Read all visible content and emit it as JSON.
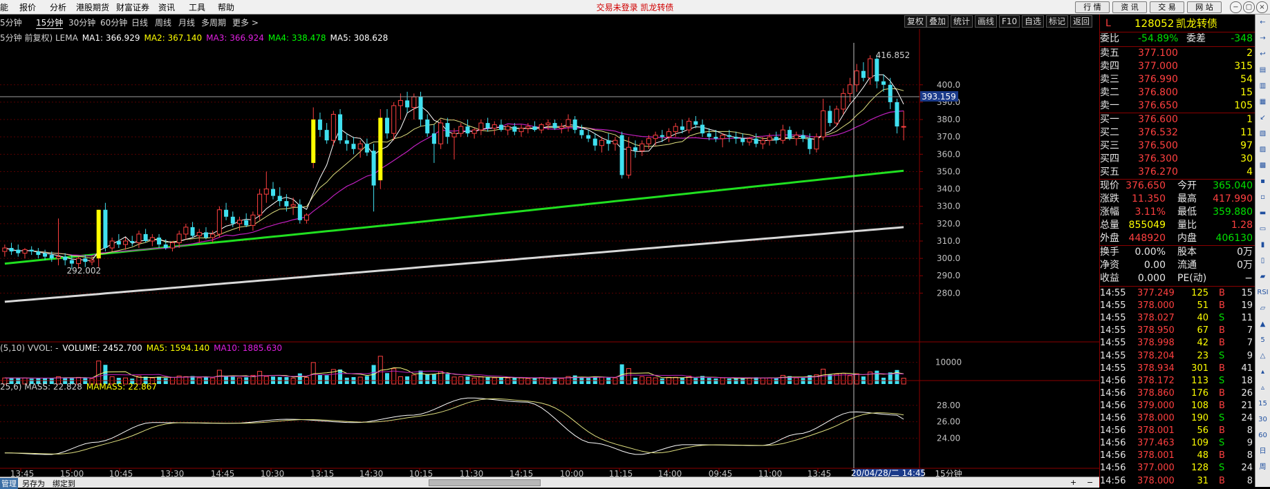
{
  "menubar": {
    "items": [
      "能",
      "报价",
      "分析",
      "港股期货",
      "财富证券",
      "资讯",
      "工具",
      "帮助"
    ],
    "center_text": "交易未登录 凯龙转债",
    "right_buttons": [
      "行 情",
      "资 讯",
      "交 易",
      "网 站"
    ],
    "window_controls": [
      "−",
      "▢",
      "×"
    ]
  },
  "tabbar": {
    "tabs": [
      "5分钟",
      "15分钟",
      "30分钟",
      "60分钟",
      "日线",
      "周线",
      "月线",
      "多周期",
      "更多 >"
    ],
    "active": "15分钟",
    "right_tabs": [
      "复权",
      "叠加",
      "统计",
      "画线",
      "F10",
      "自选",
      "标记",
      "返回"
    ]
  },
  "indicator_lines": {
    "main": {
      "prefix": "5分钟 前复权) LEMA",
      "items": [
        {
          "label": "MA1: 366.929",
          "color": "#ffffff"
        },
        {
          "label": "MA2: 367.140",
          "color": "#ffff00"
        },
        {
          "label": "MA3: 366.924",
          "color": "#e020e0"
        },
        {
          "label": "MA4: 338.478",
          "color": "#00ff00"
        },
        {
          "label": "MA5: 308.628",
          "color": "#ffffff"
        }
      ]
    },
    "volume": {
      "prefix": "(5,10) VVOL: -",
      "items": [
        {
          "label": "VOLUME: 2452.700",
          "color": "#ffffff"
        },
        {
          "label": "MA5: 1594.140",
          "color": "#ffff00"
        },
        {
          "label": "MA10: 1885.630",
          "color": "#e020e0"
        }
      ]
    },
    "mass": {
      "prefix": "25,6) MASS: 22.828",
      "items": [
        {
          "label": "MAMASS: 22.867",
          "color": "#ffff00"
        }
      ]
    }
  },
  "chart_data": {
    "type": "candlestick",
    "price_axis": {
      "ticks": [
        280,
        290,
        300,
        310,
        320,
        330,
        340,
        350,
        360,
        370,
        380,
        390,
        400
      ],
      "ylim": [
        271,
        421
      ]
    },
    "price_marker": "393.159",
    "high_label": "416.852",
    "low_label": "292.002",
    "volume_axis": {
      "ticks": [
        10000
      ]
    },
    "mass_axis": {
      "ticks": [
        "24.00",
        "26.00",
        "28.00"
      ],
      "ylim": [
        21,
        29.5
      ]
    },
    "x_labels": [
      "13:45",
      "15:00",
      "10:45",
      "13:30",
      "14:45",
      "10:30",
      "13:15",
      "14:30",
      "10:15",
      "11:30",
      "14:15",
      "10:00",
      "11:15",
      "14:00",
      "09:45",
      "11:00",
      "13:45",
      "14:45",
      "13:30",
      "14:45"
    ],
    "cursor_label": "20/04/28/二 14:45",
    "period_label": "15分钟",
    "candles": [
      {
        "o": 304,
        "h": 308,
        "l": 301,
        "c": 306
      },
      {
        "o": 306,
        "h": 309,
        "l": 302,
        "c": 304
      },
      {
        "o": 305,
        "h": 308,
        "l": 301,
        "c": 303
      },
      {
        "o": 303,
        "h": 306,
        "l": 300,
        "c": 305
      },
      {
        "o": 305,
        "h": 307,
        "l": 302,
        "c": 304
      },
      {
        "o": 304,
        "h": 306,
        "l": 300,
        "c": 302
      },
      {
        "o": 303,
        "h": 305,
        "l": 299,
        "c": 301
      },
      {
        "o": 302,
        "h": 304,
        "l": 298,
        "c": 300
      },
      {
        "o": 300,
        "h": 323,
        "l": 296,
        "c": 301
      },
      {
        "o": 301,
        "h": 303,
        "l": 296,
        "c": 299
      },
      {
        "o": 299,
        "h": 302,
        "l": 294,
        "c": 297
      },
      {
        "o": 297,
        "h": 301,
        "l": 294,
        "c": 300
      },
      {
        "o": 300,
        "h": 302,
        "l": 295,
        "c": 298
      },
      {
        "o": 298,
        "h": 301,
        "l": 296,
        "c": 299
      },
      {
        "o": 300,
        "h": 328,
        "l": 295,
        "c": 328
      },
      {
        "o": 328,
        "h": 332,
        "l": 304,
        "c": 306
      },
      {
        "o": 306,
        "h": 312,
        "l": 304,
        "c": 310
      },
      {
        "o": 310,
        "h": 314,
        "l": 306,
        "c": 308
      },
      {
        "o": 308,
        "h": 312,
        "l": 305,
        "c": 310
      },
      {
        "o": 310,
        "h": 313,
        "l": 307,
        "c": 309
      },
      {
        "o": 309,
        "h": 316,
        "l": 306,
        "c": 314
      },
      {
        "o": 314,
        "h": 317,
        "l": 309,
        "c": 310
      },
      {
        "o": 310,
        "h": 314,
        "l": 307,
        "c": 312
      },
      {
        "o": 312,
        "h": 314,
        "l": 306,
        "c": 308
      },
      {
        "o": 308,
        "h": 311,
        "l": 305,
        "c": 306
      },
      {
        "o": 306,
        "h": 310,
        "l": 304,
        "c": 309
      },
      {
        "o": 309,
        "h": 316,
        "l": 306,
        "c": 314
      },
      {
        "o": 314,
        "h": 320,
        "l": 311,
        "c": 318
      },
      {
        "o": 318,
        "h": 321,
        "l": 312,
        "c": 313
      },
      {
        "o": 313,
        "h": 317,
        "l": 309,
        "c": 315
      },
      {
        "o": 315,
        "h": 318,
        "l": 311,
        "c": 312
      },
      {
        "o": 312,
        "h": 316,
        "l": 309,
        "c": 314
      },
      {
        "o": 314,
        "h": 330,
        "l": 312,
        "c": 328
      },
      {
        "o": 328,
        "h": 332,
        "l": 322,
        "c": 324
      },
      {
        "o": 324,
        "h": 327,
        "l": 318,
        "c": 320
      },
      {
        "o": 320,
        "h": 324,
        "l": 316,
        "c": 322
      },
      {
        "o": 322,
        "h": 326,
        "l": 318,
        "c": 319
      },
      {
        "o": 319,
        "h": 327,
        "l": 316,
        "c": 325
      },
      {
        "o": 325,
        "h": 340,
        "l": 322,
        "c": 337
      },
      {
        "o": 337,
        "h": 350,
        "l": 332,
        "c": 340
      },
      {
        "o": 340,
        "h": 344,
        "l": 334,
        "c": 336
      },
      {
        "o": 336,
        "h": 341,
        "l": 330,
        "c": 333
      },
      {
        "o": 333,
        "h": 337,
        "l": 327,
        "c": 330
      },
      {
        "o": 330,
        "h": 335,
        "l": 325,
        "c": 331
      },
      {
        "o": 331,
        "h": 334,
        "l": 320,
        "c": 322
      },
      {
        "o": 322,
        "h": 326,
        "l": 320,
        "c": 325
      },
      {
        "o": 355,
        "h": 387,
        "l": 352,
        "c": 380
      },
      {
        "o": 380,
        "h": 384,
        "l": 370,
        "c": 374
      },
      {
        "o": 374,
        "h": 378,
        "l": 366,
        "c": 368
      },
      {
        "o": 368,
        "h": 385,
        "l": 365,
        "c": 383
      },
      {
        "o": 383,
        "h": 386,
        "l": 366,
        "c": 368
      },
      {
        "o": 368,
        "h": 372,
        "l": 362,
        "c": 366
      },
      {
        "o": 366,
        "h": 370,
        "l": 360,
        "c": 363
      },
      {
        "o": 363,
        "h": 368,
        "l": 358,
        "c": 366
      },
      {
        "o": 366,
        "h": 369,
        "l": 359,
        "c": 361
      },
      {
        "o": 362,
        "h": 366,
        "l": 327,
        "c": 342
      },
      {
        "o": 345,
        "h": 386,
        "l": 340,
        "c": 381
      },
      {
        "o": 381,
        "h": 386,
        "l": 369,
        "c": 372
      },
      {
        "o": 372,
        "h": 390,
        "l": 368,
        "c": 388
      },
      {
        "o": 388,
        "h": 395,
        "l": 380,
        "c": 391
      },
      {
        "o": 391,
        "h": 396,
        "l": 384,
        "c": 387
      },
      {
        "o": 387,
        "h": 395,
        "l": 380,
        "c": 393
      },
      {
        "o": 393,
        "h": 396,
        "l": 376,
        "c": 380
      },
      {
        "o": 380,
        "h": 383,
        "l": 370,
        "c": 372
      },
      {
        "o": 372,
        "h": 377,
        "l": 355,
        "c": 366
      },
      {
        "o": 366,
        "h": 380,
        "l": 363,
        "c": 378
      },
      {
        "o": 378,
        "h": 381,
        "l": 366,
        "c": 370
      },
      {
        "o": 370,
        "h": 375,
        "l": 357,
        "c": 372
      },
      {
        "o": 372,
        "h": 378,
        "l": 370,
        "c": 376
      },
      {
        "o": 376,
        "h": 380,
        "l": 370,
        "c": 372
      },
      {
        "o": 372,
        "h": 375,
        "l": 369,
        "c": 374
      },
      {
        "o": 374,
        "h": 380,
        "l": 371,
        "c": 378
      },
      {
        "o": 378,
        "h": 381,
        "l": 373,
        "c": 375
      },
      {
        "o": 375,
        "h": 379,
        "l": 371,
        "c": 377
      },
      {
        "o": 377,
        "h": 380,
        "l": 373,
        "c": 374
      },
      {
        "o": 374,
        "h": 377,
        "l": 371,
        "c": 376
      },
      {
        "o": 376,
        "h": 378,
        "l": 371,
        "c": 373
      },
      {
        "o": 373,
        "h": 377,
        "l": 370,
        "c": 375
      },
      {
        "o": 375,
        "h": 378,
        "l": 372,
        "c": 376
      },
      {
        "o": 376,
        "h": 379,
        "l": 373,
        "c": 374
      },
      {
        "o": 374,
        "h": 378,
        "l": 372,
        "c": 377
      },
      {
        "o": 377,
        "h": 380,
        "l": 374,
        "c": 378
      },
      {
        "o": 378,
        "h": 380,
        "l": 374,
        "c": 375
      },
      {
        "o": 375,
        "h": 378,
        "l": 372,
        "c": 376
      },
      {
        "o": 376,
        "h": 383,
        "l": 373,
        "c": 380
      },
      {
        "o": 380,
        "h": 382,
        "l": 372,
        "c": 374
      },
      {
        "o": 374,
        "h": 377,
        "l": 369,
        "c": 371
      },
      {
        "o": 371,
        "h": 374,
        "l": 367,
        "c": 369
      },
      {
        "o": 369,
        "h": 372,
        "l": 362,
        "c": 365
      },
      {
        "o": 365,
        "h": 370,
        "l": 361,
        "c": 368
      },
      {
        "o": 368,
        "h": 372,
        "l": 362,
        "c": 366
      },
      {
        "o": 366,
        "h": 370,
        "l": 362,
        "c": 368
      },
      {
        "o": 371,
        "h": 373,
        "l": 346,
        "c": 348
      },
      {
        "o": 348,
        "h": 370,
        "l": 346,
        "c": 364
      },
      {
        "o": 364,
        "h": 368,
        "l": 358,
        "c": 362
      },
      {
        "o": 362,
        "h": 368,
        "l": 359,
        "c": 366
      },
      {
        "o": 366,
        "h": 371,
        "l": 363,
        "c": 369
      },
      {
        "o": 369,
        "h": 373,
        "l": 365,
        "c": 371
      },
      {
        "o": 371,
        "h": 374,
        "l": 367,
        "c": 370
      },
      {
        "o": 370,
        "h": 375,
        "l": 367,
        "c": 373
      },
      {
        "o": 373,
        "h": 378,
        "l": 370,
        "c": 376
      },
      {
        "o": 376,
        "h": 380,
        "l": 372,
        "c": 374
      },
      {
        "o": 374,
        "h": 381,
        "l": 372,
        "c": 379
      },
      {
        "o": 379,
        "h": 382,
        "l": 375,
        "c": 377
      },
      {
        "o": 377,
        "h": 380,
        "l": 370,
        "c": 372
      },
      {
        "o": 372,
        "h": 375,
        "l": 368,
        "c": 370
      },
      {
        "o": 370,
        "h": 374,
        "l": 367,
        "c": 369
      },
      {
        "o": 369,
        "h": 372,
        "l": 364,
        "c": 371
      },
      {
        "o": 371,
        "h": 374,
        "l": 367,
        "c": 370
      },
      {
        "o": 370,
        "h": 373,
        "l": 366,
        "c": 369
      },
      {
        "o": 369,
        "h": 372,
        "l": 365,
        "c": 367
      },
      {
        "o": 367,
        "h": 370,
        "l": 365,
        "c": 369
      },
      {
        "o": 369,
        "h": 372,
        "l": 364,
        "c": 366
      },
      {
        "o": 366,
        "h": 370,
        "l": 363,
        "c": 368
      },
      {
        "o": 368,
        "h": 372,
        "l": 365,
        "c": 370
      },
      {
        "o": 370,
        "h": 373,
        "l": 366,
        "c": 368
      },
      {
        "o": 368,
        "h": 377,
        "l": 366,
        "c": 374
      },
      {
        "o": 374,
        "h": 376,
        "l": 368,
        "c": 369
      },
      {
        "o": 369,
        "h": 373,
        "l": 365,
        "c": 371
      },
      {
        "o": 371,
        "h": 374,
        "l": 367,
        "c": 369
      },
      {
        "o": 369,
        "h": 372,
        "l": 360,
        "c": 363
      },
      {
        "o": 363,
        "h": 372,
        "l": 361,
        "c": 370
      },
      {
        "o": 370,
        "h": 392,
        "l": 368,
        "c": 385
      },
      {
        "o": 385,
        "h": 388,
        "l": 376,
        "c": 378
      },
      {
        "o": 378,
        "h": 388,
        "l": 376,
        "c": 386
      },
      {
        "o": 386,
        "h": 398,
        "l": 383,
        "c": 395
      },
      {
        "o": 395,
        "h": 404,
        "l": 390,
        "c": 400
      },
      {
        "o": 400,
        "h": 412,
        "l": 396,
        "c": 408
      },
      {
        "o": 408,
        "h": 413,
        "l": 402,
        "c": 404
      },
      {
        "o": 404,
        "h": 417,
        "l": 400,
        "c": 415
      },
      {
        "o": 415,
        "h": 417,
        "l": 398,
        "c": 402
      },
      {
        "o": 402,
        "h": 406,
        "l": 396,
        "c": 400
      },
      {
        "o": 400,
        "h": 404,
        "l": 386,
        "c": 390
      },
      {
        "o": 390,
        "h": 392,
        "l": 372,
        "c": 376
      },
      {
        "o": 376,
        "h": 385,
        "l": 368,
        "c": 376
      }
    ]
  },
  "quote": {
    "code": "L",
    "code_num": "128052",
    "name": "凯龙转债",
    "weibi": {
      "label": "委比",
      "value": "-54.89%",
      "label2": "委差",
      "value2": "-348"
    },
    "sells": [
      {
        "label": "卖五",
        "price": "377.100",
        "vol": "2"
      },
      {
        "label": "卖四",
        "price": "377.000",
        "vol": "315"
      },
      {
        "label": "卖三",
        "price": "376.990",
        "vol": "54"
      },
      {
        "label": "卖二",
        "price": "376.800",
        "vol": "15"
      },
      {
        "label": "卖一",
        "price": "376.650",
        "vol": "105"
      }
    ],
    "buys": [
      {
        "label": "买一",
        "price": "376.600",
        "vol": "1"
      },
      {
        "label": "买二",
        "price": "376.532",
        "vol": "11"
      },
      {
        "label": "买三",
        "price": "376.500",
        "vol": "97"
      },
      {
        "label": "买四",
        "price": "376.300",
        "vol": "30"
      },
      {
        "label": "买五",
        "price": "376.270",
        "vol": "4"
      }
    ],
    "stats": [
      {
        "l1": "现价",
        "v1": "376.650",
        "c1": "red",
        "l2": "今开",
        "v2": "365.040",
        "c2": "green"
      },
      {
        "l1": "涨跌",
        "v1": "11.350",
        "c1": "red",
        "l2": "最高",
        "v2": "417.990",
        "c2": "red"
      },
      {
        "l1": "涨幅",
        "v1": "3.11%",
        "c1": "red",
        "l2": "最低",
        "v2": "359.880",
        "c2": "green"
      },
      {
        "l1": "总量",
        "v1": "855049",
        "c1": "yellow",
        "l2": "量比",
        "v2": "1.28",
        "c2": "red"
      },
      {
        "l1": "外盘",
        "v1": "448920",
        "c1": "red",
        "l2": "内盘",
        "v2": "406130",
        "c2": "green"
      }
    ],
    "stats2": [
      {
        "l1": "换手",
        "v1": "0.00%",
        "l2": "股本",
        "v2": "0万"
      },
      {
        "l1": "净资",
        "v1": "0.00",
        "l2": "流通",
        "v2": "0万"
      },
      {
        "l1": "收益",
        "v1": "0.000",
        "l2": "PE(动)",
        "v2": "−"
      }
    ],
    "ticks": [
      {
        "t": "14:55",
        "p": "377.249",
        "v": "125",
        "s": "B",
        "n": "15"
      },
      {
        "t": "14:55",
        "p": "378.000",
        "v": "51",
        "s": "B",
        "n": "19"
      },
      {
        "t": "14:55",
        "p": "378.027",
        "v": "40",
        "s": "S",
        "n": "11"
      },
      {
        "t": "14:55",
        "p": "378.950",
        "v": "67",
        "s": "B",
        "n": "7"
      },
      {
        "t": "14:55",
        "p": "378.998",
        "v": "42",
        "s": "B",
        "n": "7"
      },
      {
        "t": "14:55",
        "p": "378.204",
        "v": "23",
        "s": "S",
        "n": "9"
      },
      {
        "t": "14:55",
        "p": "378.934",
        "v": "301",
        "s": "B",
        "n": "41"
      },
      {
        "t": "14:56",
        "p": "378.172",
        "v": "113",
        "s": "S",
        "n": "18"
      },
      {
        "t": "14:56",
        "p": "378.860",
        "v": "176",
        "s": "B",
        "n": "26"
      },
      {
        "t": "14:56",
        "p": "379.000",
        "v": "108",
        "s": "B",
        "n": "21"
      },
      {
        "t": "14:56",
        "p": "378.000",
        "v": "190",
        "s": "S",
        "n": "24"
      },
      {
        "t": "14:56",
        "p": "378.001",
        "v": "56",
        "s": "B",
        "n": "8"
      },
      {
        "t": "14:56",
        "p": "377.463",
        "v": "109",
        "s": "S",
        "n": "9"
      },
      {
        "t": "14:56",
        "p": "378.001",
        "v": "48",
        "s": "B",
        "n": "8"
      },
      {
        "t": "14:56",
        "p": "377.000",
        "v": "128",
        "s": "S",
        "n": "24"
      },
      {
        "t": "14:56",
        "p": "378.000",
        "v": "31",
        "s": "B",
        "n": "8"
      }
    ]
  },
  "sidebar": {
    "icons": [
      "←",
      "→",
      "↩",
      "▤",
      "▥",
      "▦",
      "↙",
      "▧",
      "▨",
      "▩",
      "▪",
      "▫",
      "▬",
      "▭",
      "▮",
      "▯",
      "▰",
      "RSI",
      "▱",
      "▲",
      "5",
      "△",
      "▴",
      "▵",
      "15",
      "30",
      "60",
      "日",
      "周"
    ]
  },
  "statusbar": {
    "items": [
      "管理",
      "另存为",
      "绑定到"
    ],
    "right": [
      "+",
      "−"
    ]
  }
}
